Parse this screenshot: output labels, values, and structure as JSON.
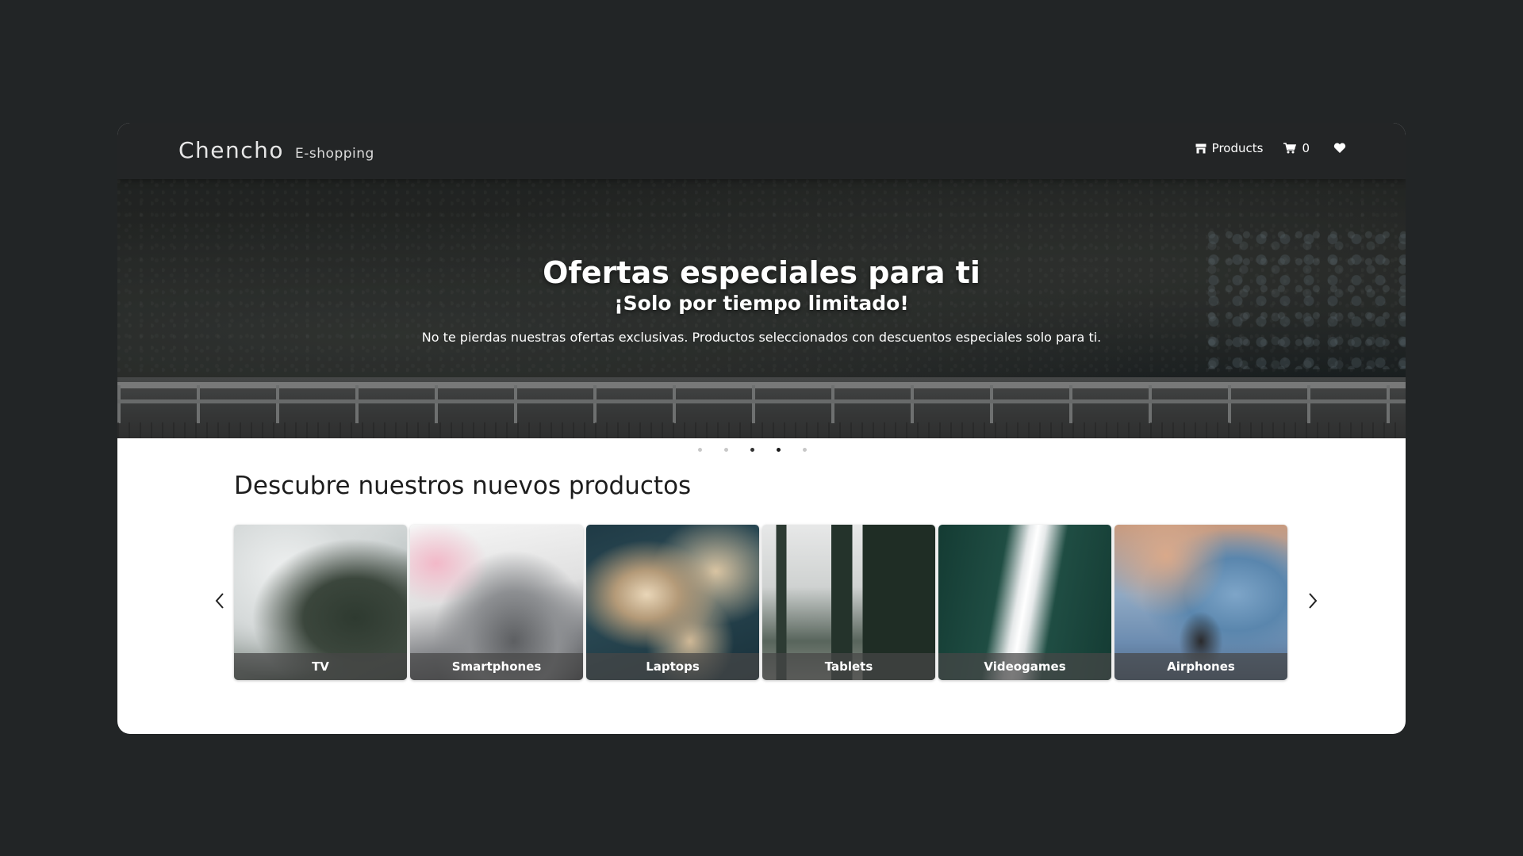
{
  "navbar": {
    "brand_name": "Chencho",
    "brand_tag": "E-shopping",
    "products_label": "Products",
    "cart_count": "0"
  },
  "hero": {
    "title": "Ofertas especiales para ti",
    "subtitle": "¡Solo por tiempo limitado!",
    "description": "No te pierdas nuestras ofertas exclusivas. Productos seleccionados con descuentos especiales solo para ti.",
    "dots_count": 5,
    "active_dot": 4
  },
  "section": {
    "title": "Descubre nuestros nuevos productos"
  },
  "categories": [
    {
      "label": "TV"
    },
    {
      "label": "Smartphones"
    },
    {
      "label": "Laptops"
    },
    {
      "label": "Tablets"
    },
    {
      "label": "Videogames"
    },
    {
      "label": "Airphones"
    }
  ],
  "icons": {
    "products": "store-icon",
    "cart": "cart-icon",
    "favorites": "heart-icon",
    "prev": "chevron-left-icon",
    "next": "chevron-right-icon"
  }
}
